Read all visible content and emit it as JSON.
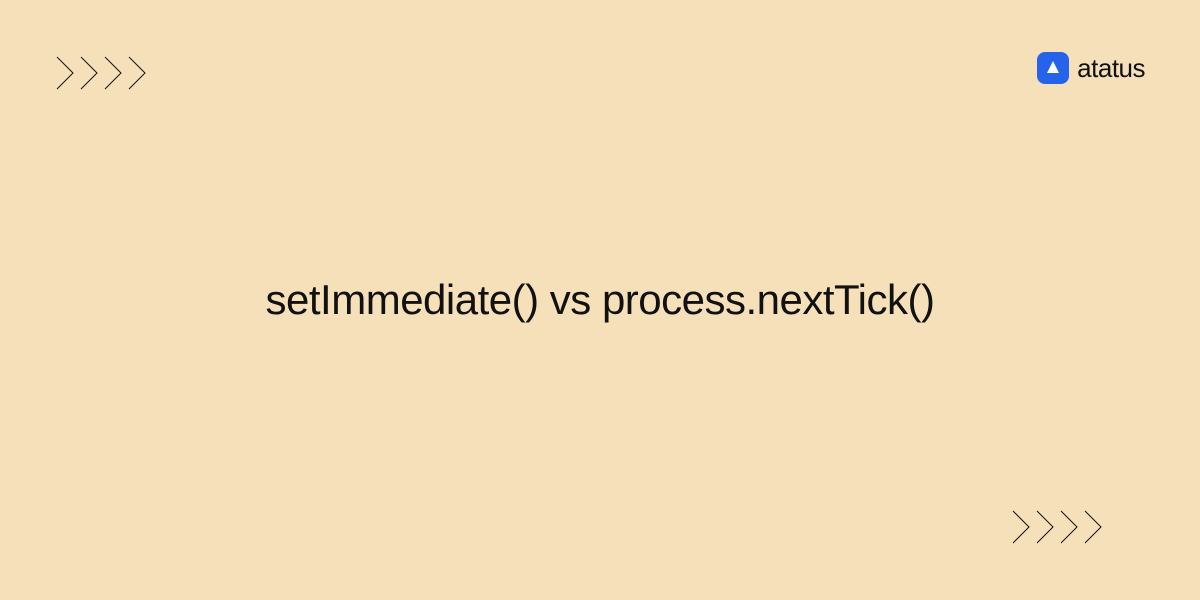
{
  "title": "setImmediate() vs process.nextTick()",
  "brand": {
    "name": "atatus"
  },
  "colors": {
    "background": "#f5e0ba",
    "brand_icon": "#2563eb",
    "text": "#111"
  }
}
